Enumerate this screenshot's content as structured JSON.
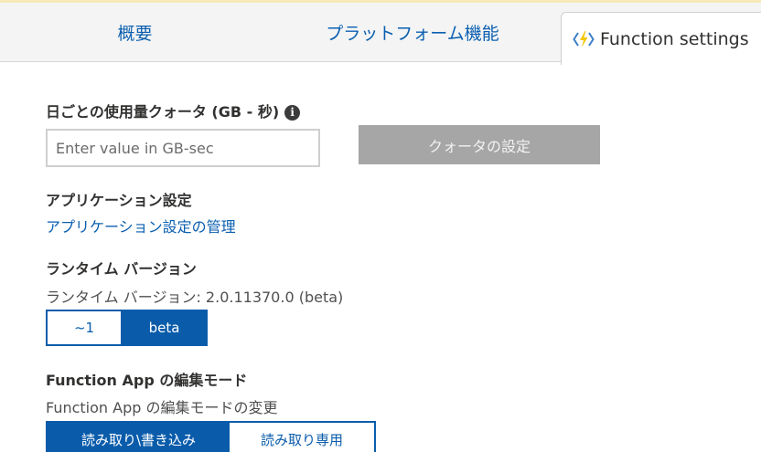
{
  "tabs": {
    "overview": "概要",
    "platform": "プラットフォーム機能",
    "settings": "Function settings"
  },
  "quota": {
    "label": "日ごとの使用量クォータ (GB - 秒)",
    "input_placeholder": "Enter value in GB-sec",
    "input_value": "",
    "button_label": "クォータの設定"
  },
  "app_settings": {
    "heading": "アプリケーション設定",
    "link": "アプリケーション設定の管理"
  },
  "runtime": {
    "heading": "ランタイム バージョン",
    "current": "ランタイム バージョン: 2.0.11370.0 (beta)",
    "options": [
      "~1",
      "beta"
    ],
    "selected": "beta"
  },
  "edit_mode": {
    "heading": "Function App の編集モード",
    "description": "Function App の編集モードの変更",
    "options": [
      "読み取り\\書き込み",
      "読み取り専用"
    ],
    "selected": "読み取り\\書き込み"
  },
  "colors": {
    "accent": "#0a5cab",
    "link": "#0a5fb0",
    "disabled_button": "#a6a6a6",
    "function_icon_bolt": "#f2c811",
    "function_icon_brackets": "#3b7fc4"
  },
  "icons": {
    "settings_tab": "function-bolt-icon",
    "quota_info": "info-icon"
  }
}
